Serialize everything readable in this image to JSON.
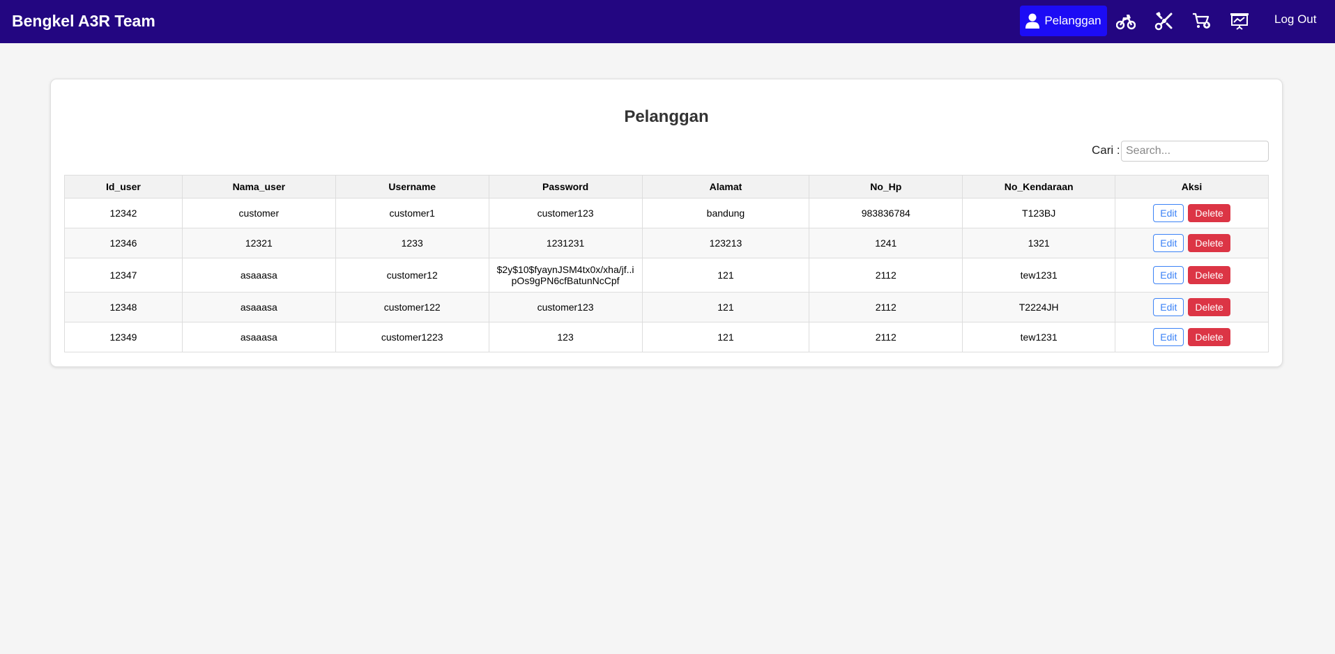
{
  "brand": "Bengkel A3R Team",
  "nav": {
    "active_label": "Pelanggan",
    "icons": [
      "user-icon",
      "motorcycle-icon",
      "wrench-icon",
      "cart-icon",
      "presentation-chart-icon"
    ],
    "logout": "Log Out"
  },
  "colors": {
    "navbar": "#230681",
    "active_nav": "#1c0cf5",
    "edit": "#3b82f6",
    "delete": "#dc3545"
  },
  "page": {
    "title": "Pelanggan",
    "search_label": "Cari :",
    "search_placeholder": "Search..."
  },
  "table": {
    "headers": [
      "Id_user",
      "Nama_user",
      "Username",
      "Password",
      "Alamat",
      "No_Hp",
      "No_Kendaraan",
      "Aksi"
    ],
    "edit_label": "Edit",
    "delete_label": "Delete",
    "rows": [
      [
        "12342",
        "customer",
        "customer1",
        "customer123",
        "bandung",
        "983836784",
        "T123BJ"
      ],
      [
        "12346",
        "12321",
        "1233",
        "1231231",
        "123213",
        "1241",
        "1321"
      ],
      [
        "12347",
        "asaaasa",
        "customer12",
        "$2y$10$fyaynJSM4tx0x/xha/jf..ipOs9gPN6cfBatunNcCpf",
        "121",
        "2112",
        "tew1231"
      ],
      [
        "12348",
        "asaaasa",
        "customer122",
        "customer123",
        "121",
        "2112",
        "T2224JH"
      ],
      [
        "12349",
        "asaaasa",
        "customer1223",
        "123",
        "121",
        "2112",
        "tew1231"
      ]
    ]
  }
}
